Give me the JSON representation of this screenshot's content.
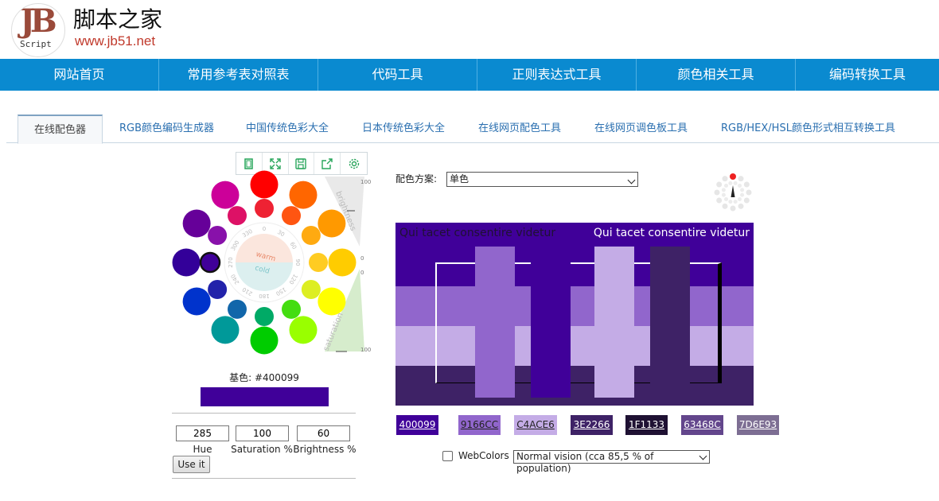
{
  "site": {
    "logo_text": "JB",
    "logo_script": "Script",
    "name": "脚本之家",
    "url": "www.jb51.net"
  },
  "nav": [
    "网站首页",
    "常用参考表对照表",
    "代码工具",
    "正则表达式工具",
    "颜色相关工具",
    "编码转换工具"
  ],
  "tabs": [
    {
      "label": "在线配色器",
      "active": true
    },
    {
      "label": "RGB颜色编码生成器"
    },
    {
      "label": "中国传统色彩大全"
    },
    {
      "label": "日本传统色彩大全"
    },
    {
      "label": "在线网页配色工具"
    },
    {
      "label": "在线网页调色板工具"
    },
    {
      "label": "RGB/HEX/HSL颜色形式相互转换工具"
    }
  ],
  "toolbar_icons": [
    "copy-icon",
    "fullscreen-icon",
    "save-icon",
    "export-icon",
    "settings-icon"
  ],
  "wheel": {
    "degrees": [
      "0",
      "30",
      "60",
      "90",
      "120",
      "150",
      "180",
      "210",
      "240",
      "270",
      "300",
      "330"
    ],
    "warm": "warm",
    "cold": "cold",
    "brightness_label": "brightness",
    "saturation_label": "saturation",
    "scale_top": "100",
    "scale_mid_a": "0",
    "scale_mid_b": "0",
    "scale_bottom": "100",
    "outer_colors": [
      "#ff0000",
      "#ff6600",
      "#ff9900",
      "#ffcc00",
      "#ffff00",
      "#99ff00",
      "#00cc00",
      "#009999",
      "#0033cc",
      "#330099",
      "#660099",
      "#cc0099"
    ],
    "inner_colors": [
      "#ee2233",
      "#ff5511",
      "#ffaa11",
      "#ffcc22",
      "#ddee22",
      "#44dd11",
      "#00aa66",
      "#1166aa",
      "#2222aa",
      "#400099",
      "#8811aa",
      "#dd1166"
    ]
  },
  "base": {
    "label": "基色: #400099",
    "color": "#400099"
  },
  "inputs": {
    "hue": "285",
    "saturation": "100",
    "brightness": "60"
  },
  "input_labels": {
    "hue": "Hue",
    "saturation": "Saturation %",
    "brightness": "Brightness %"
  },
  "use_button": "Use it",
  "scheme": {
    "label": "配色方案:",
    "value": "单色"
  },
  "preview": {
    "text_left": "Qui tacet consentire videtur",
    "text_right": "Qui tacet consentire videtur",
    "colors": [
      "#400099",
      "#9166CC",
      "#C4ACE6",
      "#3E2266",
      "#1F1133",
      "#63468C",
      "#7D6E93"
    ]
  },
  "swatches": [
    {
      "hex": "400099",
      "color": "#400099",
      "text_color": "#ffffff"
    },
    {
      "hex": "9166CC",
      "color": "#9166CC",
      "text_color": "#222222"
    },
    {
      "hex": "C4ACE6",
      "color": "#C4ACE6",
      "text_color": "#222222"
    },
    {
      "hex": "3E2266",
      "color": "#3E2266",
      "text_color": "#ffffff"
    },
    {
      "hex": "1F1133",
      "color": "#1F1133",
      "text_color": "#ffffff"
    },
    {
      "hex": "63468C",
      "color": "#63468C",
      "text_color": "#ffffff"
    },
    {
      "hex": "7D6E93",
      "color": "#7D6E93",
      "text_color": "#ffffff"
    }
  ],
  "webcolors_label": "WebColors",
  "vision": {
    "value": "Normal vision (cca 85,5 % of population)"
  },
  "accent": "#0a8ad0"
}
